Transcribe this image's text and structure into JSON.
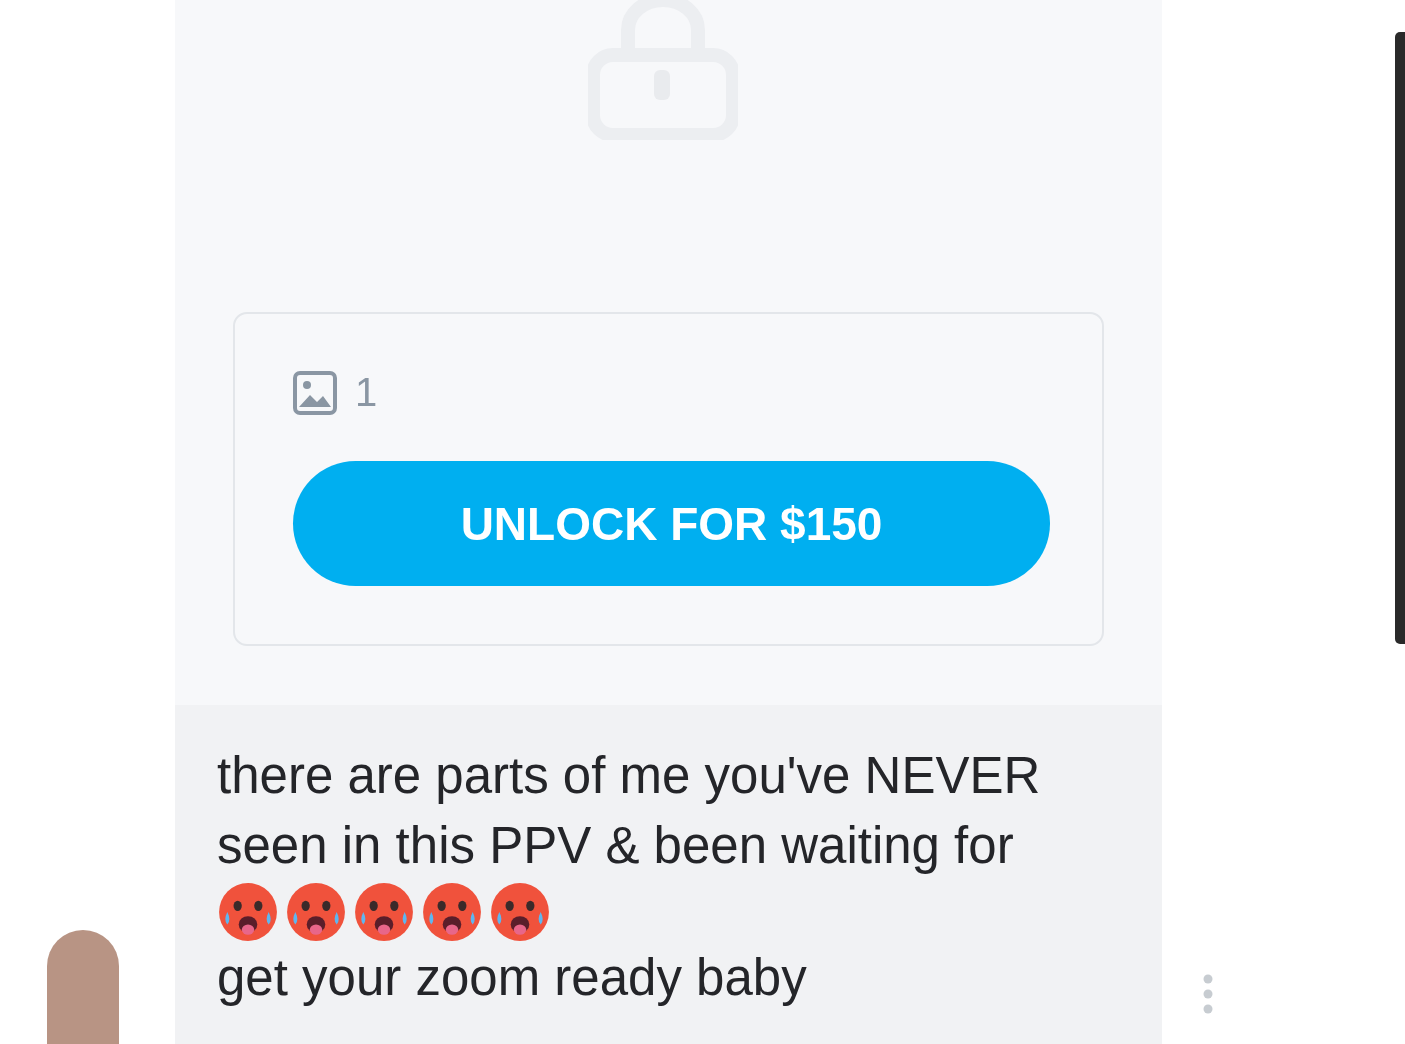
{
  "locked_post": {
    "media_count": "1",
    "unlock_button": "UNLOCK FOR $150"
  },
  "message": {
    "parts": [
      {
        "kind": "text",
        "text": "there are parts of me you've NEVER seen in this PPV & been waiting for"
      },
      {
        "kind": "emoji"
      },
      {
        "kind": "emoji"
      },
      {
        "kind": "emoji"
      },
      {
        "kind": "emoji"
      },
      {
        "kind": "emoji"
      },
      {
        "kind": "text",
        "text": "get your zoom ready baby"
      }
    ]
  }
}
